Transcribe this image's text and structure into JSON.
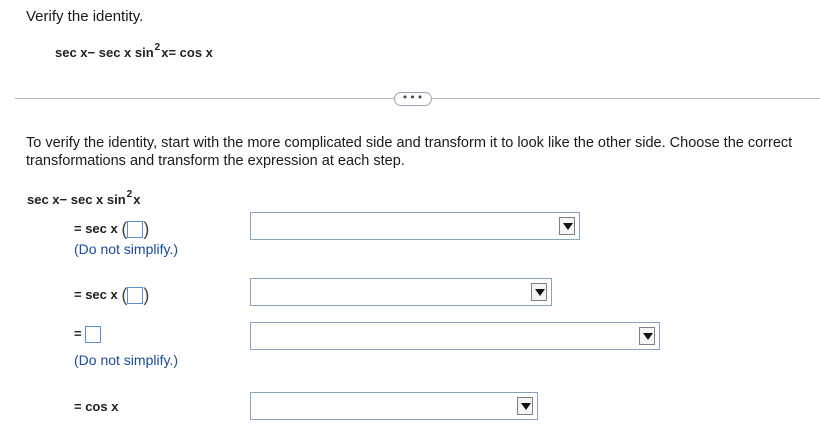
{
  "prompt": "Verify the identity.",
  "identity": {
    "part1": "sec x− sec x sin",
    "exp": "2",
    "part2": "x= cos x"
  },
  "more_button": "•••",
  "instructions": "To verify the identity, start with the more complicated side and transform it to look like the other side. Choose the correct transformations and transform the expression at each step.",
  "start": {
    "part1": "sec x− sec x sin",
    "exp": "2",
    "part2": "x"
  },
  "steps": [
    {
      "prefix": "= sec x",
      "note": "(Do not simplify.)"
    },
    {
      "prefix": "= sec x",
      "note": ""
    },
    {
      "prefix": "=",
      "note": "(Do not simplify.)"
    },
    {
      "prefix": "= cos x",
      "note": ""
    }
  ],
  "colors": {
    "blank_border": "#5a8fd6",
    "note_text": "#1a4a9a",
    "select_border": "#8aa2c0"
  }
}
